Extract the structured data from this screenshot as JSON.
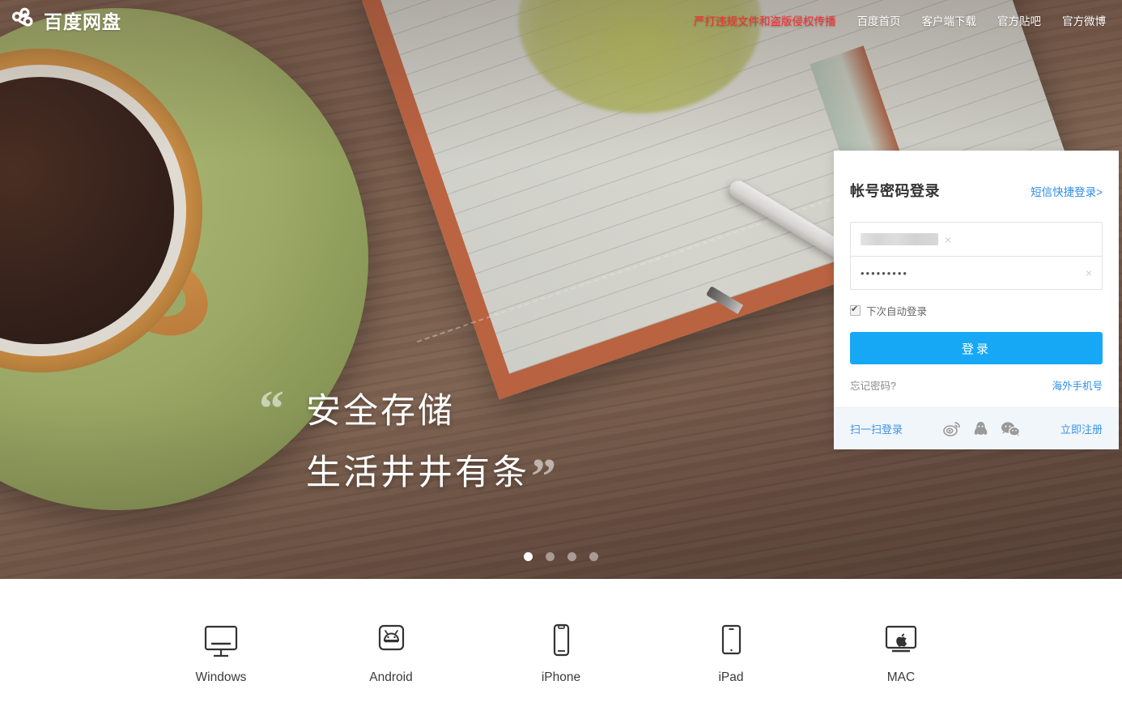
{
  "brand": {
    "logo_icon": "baidu-netdisk-cloud-icon",
    "name": "百度网盘"
  },
  "topnav": {
    "items": [
      {
        "label": "严打违规文件和盗版侵权传播",
        "style": "alert",
        "color": "#ff2d2d"
      },
      {
        "label": "百度首页",
        "style": "normal",
        "color": "#ffffff"
      },
      {
        "label": "客户端下载",
        "style": "normal",
        "color": "#ffffff"
      },
      {
        "label": "官方贴吧",
        "style": "normal",
        "color": "#ffffff"
      },
      {
        "label": "官方微博",
        "style": "normal",
        "color": "#ffffff"
      }
    ]
  },
  "hero": {
    "slogan_line1": "安全存储",
    "slogan_line2": "生活井井有条",
    "quote_open": "“",
    "quote_close": "”",
    "carousel": {
      "total": 4,
      "active_index": 0
    }
  },
  "login": {
    "title": "帐号密码登录",
    "sms_link": "短信快捷登录>",
    "username": {
      "value": "",
      "placeholder": "",
      "redacted": true,
      "clear_icon": "×"
    },
    "password": {
      "value": "•••••••••",
      "placeholder": "",
      "clear_icon": "×"
    },
    "auto_login": {
      "label": "下次自动登录",
      "checked": true
    },
    "submit_label": "登录",
    "forgot_label": "忘记密码?",
    "overseas_label": "海外手机号",
    "footer": {
      "scan_login": "扫一扫登录",
      "register": "立即注册",
      "social": [
        {
          "name": "weibo-icon",
          "title": "微博"
        },
        {
          "name": "qq-icon",
          "title": "QQ"
        },
        {
          "name": "wechat-icon",
          "title": "微信"
        }
      ]
    },
    "accent_color": "#17a8f5",
    "link_color": "#2e8ded",
    "footer_bg": "#f1f6fb"
  },
  "apps": {
    "items": [
      {
        "label": "Windows",
        "icon": "monitor-icon"
      },
      {
        "label": "Android",
        "icon": "android-icon"
      },
      {
        "label": "iPhone",
        "icon": "phone-icon"
      },
      {
        "label": "iPad",
        "icon": "tablet-icon"
      },
      {
        "label": "MAC",
        "icon": "apple-monitor-icon"
      }
    ]
  }
}
